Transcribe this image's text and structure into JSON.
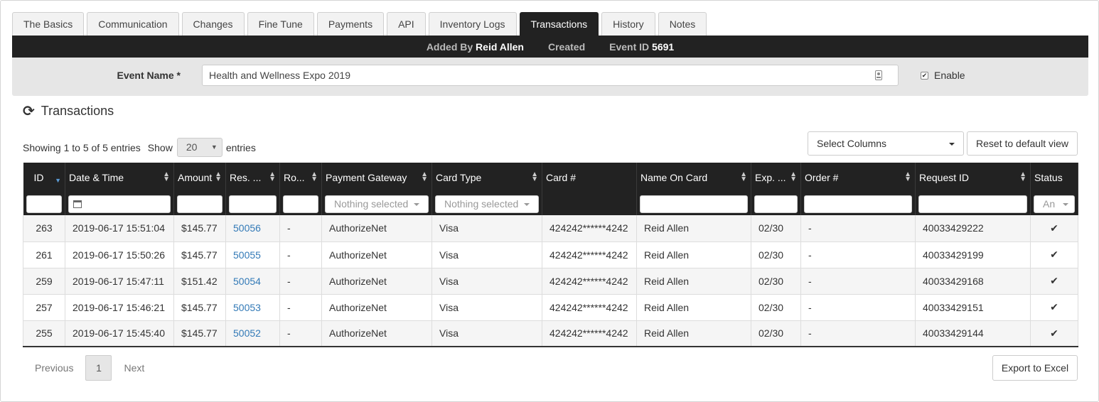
{
  "tabs": [
    {
      "label": "The Basics",
      "active": false
    },
    {
      "label": "Communication",
      "active": false
    },
    {
      "label": "Changes",
      "active": false
    },
    {
      "label": "Fine Tune",
      "active": false
    },
    {
      "label": "Payments",
      "active": false
    },
    {
      "label": "API",
      "active": false
    },
    {
      "label": "Inventory Logs",
      "active": false
    },
    {
      "label": "Transactions",
      "active": true
    },
    {
      "label": "History",
      "active": false
    },
    {
      "label": "Notes",
      "active": false
    }
  ],
  "infobar": {
    "added_by_label": "Added By",
    "added_by_value": "Reid Allen",
    "created_label": "Created",
    "event_id_label": "Event ID",
    "event_id_value": "5691"
  },
  "event": {
    "label": "Event Name *",
    "value": "Health and Wellness Expo 2019",
    "enable_label": "Enable",
    "enable_checked": true
  },
  "section": {
    "title": "Transactions"
  },
  "controls": {
    "showing_text": "Showing 1 to 5 of 5 entries",
    "show_label": "Show",
    "page_size": "20",
    "entries_label": "entries",
    "select_columns": "Select Columns",
    "reset_label": "Reset to default view"
  },
  "table": {
    "columns": [
      "ID",
      "Date & Time",
      "Amount",
      "Res. ...",
      "Ro...",
      "Payment Gateway",
      "Card Type",
      "Card #",
      "Name On Card",
      "Exp. ...",
      "Order #",
      "Request ID",
      "Status"
    ],
    "filters": {
      "payment_gateway": "Nothing selected",
      "card_type": "Nothing selected",
      "status": "An"
    },
    "rows": [
      {
        "id": "263",
        "datetime": "2019-06-17 15:51:04",
        "amount": "$145.77",
        "res": "50056",
        "ro": "-",
        "gateway": "AuthorizeNet",
        "card_type": "Visa",
        "card": "424242******4242",
        "name": "Reid Allen",
        "exp": "02/30",
        "order": "-",
        "request_id": "40033429222",
        "status": "✔"
      },
      {
        "id": "261",
        "datetime": "2019-06-17 15:50:26",
        "amount": "$145.77",
        "res": "50055",
        "ro": "-",
        "gateway": "AuthorizeNet",
        "card_type": "Visa",
        "card": "424242******4242",
        "name": "Reid Allen",
        "exp": "02/30",
        "order": "-",
        "request_id": "40033429199",
        "status": "✔"
      },
      {
        "id": "259",
        "datetime": "2019-06-17 15:47:11",
        "amount": "$151.42",
        "res": "50054",
        "ro": "-",
        "gateway": "AuthorizeNet",
        "card_type": "Visa",
        "card": "424242******4242",
        "name": "Reid Allen",
        "exp": "02/30",
        "order": "-",
        "request_id": "40033429168",
        "status": "✔"
      },
      {
        "id": "257",
        "datetime": "2019-06-17 15:46:21",
        "amount": "$145.77",
        "res": "50053",
        "ro": "-",
        "gateway": "AuthorizeNet",
        "card_type": "Visa",
        "card": "424242******4242",
        "name": "Reid Allen",
        "exp": "02/30",
        "order": "-",
        "request_id": "40033429151",
        "status": "✔"
      },
      {
        "id": "255",
        "datetime": "2019-06-17 15:45:40",
        "amount": "$145.77",
        "res": "50052",
        "ro": "-",
        "gateway": "AuthorizeNet",
        "card_type": "Visa",
        "card": "424242******4242",
        "name": "Reid Allen",
        "exp": "02/30",
        "order": "-",
        "request_id": "40033429144",
        "status": "✔"
      }
    ]
  },
  "pagination": {
    "previous": "Previous",
    "current": "1",
    "next": "Next",
    "export": "Export to Excel"
  },
  "icons": {
    "refresh": "refresh-icon",
    "calendar": "calendar-icon",
    "check": "check-icon",
    "contact": "contact-card-icon"
  },
  "colors": {
    "header_bg": "#222222",
    "link": "#337ab7",
    "success": "#3c8a3c"
  }
}
